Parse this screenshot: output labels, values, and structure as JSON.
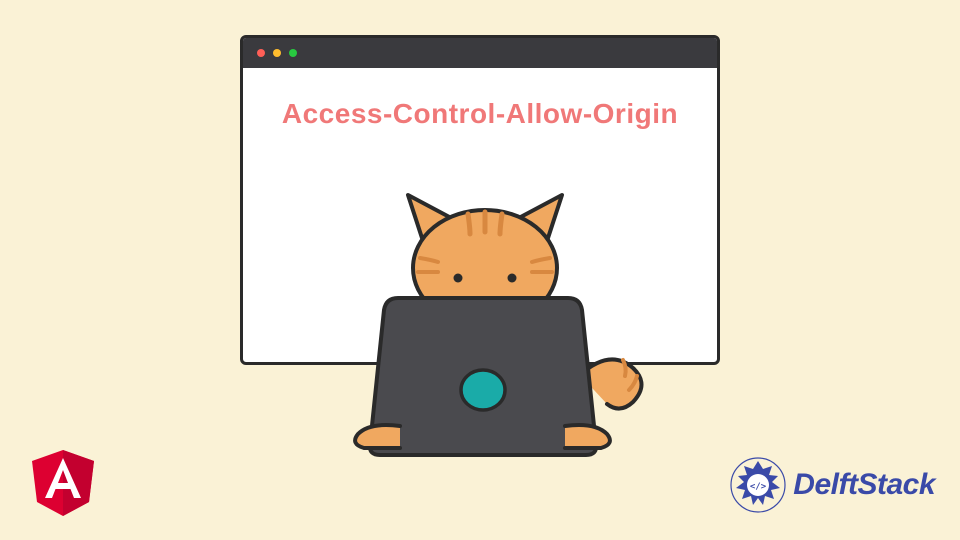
{
  "header": {
    "title": "Access-Control-Allow-Origin"
  },
  "brand": {
    "name": "DelftStack"
  },
  "colors": {
    "background": "#faf2d6",
    "headerText": "#f07878",
    "catFur": "#f0a860",
    "catStroke": "#2a2a2a",
    "laptopBody": "#4a4a4e",
    "laptopLogo": "#1aaba8",
    "angularRed": "#dd0031",
    "delftBlue": "#3a4aa8"
  }
}
